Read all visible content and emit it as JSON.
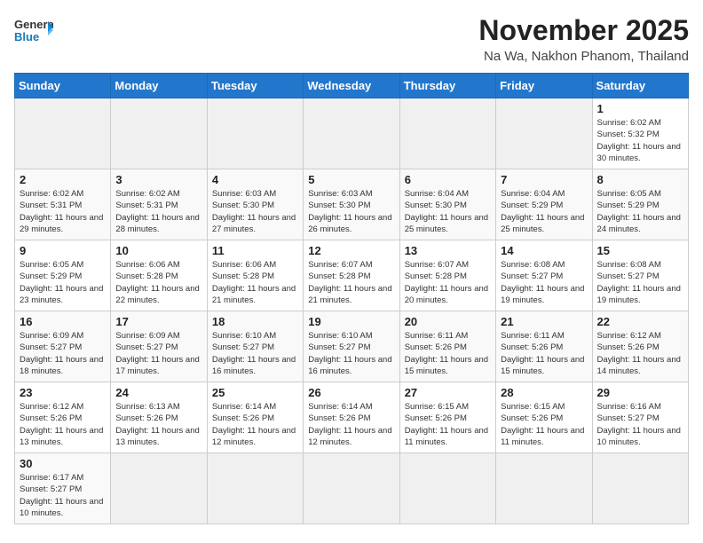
{
  "header": {
    "logo_general": "General",
    "logo_blue": "Blue",
    "month_year": "November 2025",
    "location": "Na Wa, Nakhon Phanom, Thailand"
  },
  "weekdays": [
    "Sunday",
    "Monday",
    "Tuesday",
    "Wednesday",
    "Thursday",
    "Friday",
    "Saturday"
  ],
  "weeks": [
    [
      {
        "day": "",
        "empty": true
      },
      {
        "day": "",
        "empty": true
      },
      {
        "day": "",
        "empty": true
      },
      {
        "day": "",
        "empty": true
      },
      {
        "day": "",
        "empty": true
      },
      {
        "day": "",
        "empty": true
      },
      {
        "day": "1",
        "sunrise": "6:02 AM",
        "sunset": "5:32 PM",
        "daylight": "11 hours and 30 minutes."
      }
    ],
    [
      {
        "day": "2",
        "sunrise": "6:02 AM",
        "sunset": "5:31 PM",
        "daylight": "11 hours and 29 minutes."
      },
      {
        "day": "3",
        "sunrise": "6:02 AM",
        "sunset": "5:31 PM",
        "daylight": "11 hours and 28 minutes."
      },
      {
        "day": "4",
        "sunrise": "6:03 AM",
        "sunset": "5:30 PM",
        "daylight": "11 hours and 27 minutes."
      },
      {
        "day": "5",
        "sunrise": "6:03 AM",
        "sunset": "5:30 PM",
        "daylight": "11 hours and 26 minutes."
      },
      {
        "day": "6",
        "sunrise": "6:04 AM",
        "sunset": "5:30 PM",
        "daylight": "11 hours and 25 minutes."
      },
      {
        "day": "7",
        "sunrise": "6:04 AM",
        "sunset": "5:29 PM",
        "daylight": "11 hours and 25 minutes."
      },
      {
        "day": "8",
        "sunrise": "6:05 AM",
        "sunset": "5:29 PM",
        "daylight": "11 hours and 24 minutes."
      }
    ],
    [
      {
        "day": "9",
        "sunrise": "6:05 AM",
        "sunset": "5:29 PM",
        "daylight": "11 hours and 23 minutes."
      },
      {
        "day": "10",
        "sunrise": "6:06 AM",
        "sunset": "5:28 PM",
        "daylight": "11 hours and 22 minutes."
      },
      {
        "day": "11",
        "sunrise": "6:06 AM",
        "sunset": "5:28 PM",
        "daylight": "11 hours and 21 minutes."
      },
      {
        "day": "12",
        "sunrise": "6:07 AM",
        "sunset": "5:28 PM",
        "daylight": "11 hours and 21 minutes."
      },
      {
        "day": "13",
        "sunrise": "6:07 AM",
        "sunset": "5:28 PM",
        "daylight": "11 hours and 20 minutes."
      },
      {
        "day": "14",
        "sunrise": "6:08 AM",
        "sunset": "5:27 PM",
        "daylight": "11 hours and 19 minutes."
      },
      {
        "day": "15",
        "sunrise": "6:08 AM",
        "sunset": "5:27 PM",
        "daylight": "11 hours and 19 minutes."
      }
    ],
    [
      {
        "day": "16",
        "sunrise": "6:09 AM",
        "sunset": "5:27 PM",
        "daylight": "11 hours and 18 minutes."
      },
      {
        "day": "17",
        "sunrise": "6:09 AM",
        "sunset": "5:27 PM",
        "daylight": "11 hours and 17 minutes."
      },
      {
        "day": "18",
        "sunrise": "6:10 AM",
        "sunset": "5:27 PM",
        "daylight": "11 hours and 16 minutes."
      },
      {
        "day": "19",
        "sunrise": "6:10 AM",
        "sunset": "5:27 PM",
        "daylight": "11 hours and 16 minutes."
      },
      {
        "day": "20",
        "sunrise": "6:11 AM",
        "sunset": "5:26 PM",
        "daylight": "11 hours and 15 minutes."
      },
      {
        "day": "21",
        "sunrise": "6:11 AM",
        "sunset": "5:26 PM",
        "daylight": "11 hours and 15 minutes."
      },
      {
        "day": "22",
        "sunrise": "6:12 AM",
        "sunset": "5:26 PM",
        "daylight": "11 hours and 14 minutes."
      }
    ],
    [
      {
        "day": "23",
        "sunrise": "6:12 AM",
        "sunset": "5:26 PM",
        "daylight": "11 hours and 13 minutes."
      },
      {
        "day": "24",
        "sunrise": "6:13 AM",
        "sunset": "5:26 PM",
        "daylight": "11 hours and 13 minutes."
      },
      {
        "day": "25",
        "sunrise": "6:14 AM",
        "sunset": "5:26 PM",
        "daylight": "11 hours and 12 minutes."
      },
      {
        "day": "26",
        "sunrise": "6:14 AM",
        "sunset": "5:26 PM",
        "daylight": "11 hours and 12 minutes."
      },
      {
        "day": "27",
        "sunrise": "6:15 AM",
        "sunset": "5:26 PM",
        "daylight": "11 hours and 11 minutes."
      },
      {
        "day": "28",
        "sunrise": "6:15 AM",
        "sunset": "5:26 PM",
        "daylight": "11 hours and 11 minutes."
      },
      {
        "day": "29",
        "sunrise": "6:16 AM",
        "sunset": "5:27 PM",
        "daylight": "11 hours and 10 minutes."
      }
    ],
    [
      {
        "day": "30",
        "sunrise": "6:17 AM",
        "sunset": "5:27 PM",
        "daylight": "11 hours and 10 minutes."
      },
      {
        "day": "",
        "empty": true
      },
      {
        "day": "",
        "empty": true
      },
      {
        "day": "",
        "empty": true
      },
      {
        "day": "",
        "empty": true
      },
      {
        "day": "",
        "empty": true
      },
      {
        "day": "",
        "empty": true
      }
    ]
  ],
  "labels": {
    "sunrise": "Sunrise:",
    "sunset": "Sunset:",
    "daylight": "Daylight:"
  }
}
